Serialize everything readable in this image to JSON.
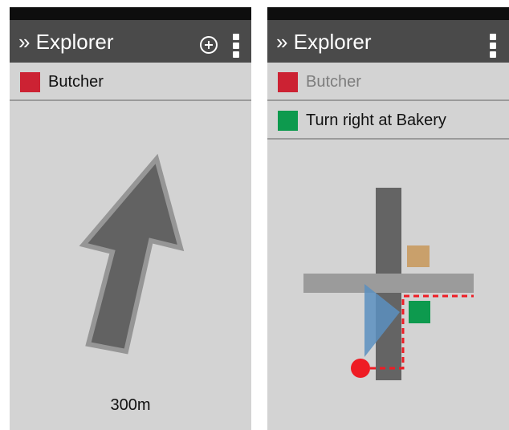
{
  "screens": {
    "left": {
      "title": "» Explorer",
      "destination": {
        "label": "Butcher",
        "color": "#cc2233"
      },
      "distance": "300m",
      "icons": [
        "add-circle-icon",
        "more-vert-icon",
        "direction-arrow-icon"
      ]
    },
    "right": {
      "title": "» Explorer",
      "destination": {
        "label": "Butcher",
        "color": "#cc2233"
      },
      "instruction": {
        "label": "Turn right at Bakery",
        "color": "#0d9a4e"
      },
      "icons": [
        "more-vert-icon"
      ],
      "map_colors": {
        "road": "#646464",
        "cross_road": "#9b9b9b",
        "building_tan": "#c9a06b",
        "bakery": "#0d9a4e",
        "view_cone": "#5b8fc0",
        "route": "#ee1c24",
        "position": "#ee1c24"
      }
    }
  }
}
